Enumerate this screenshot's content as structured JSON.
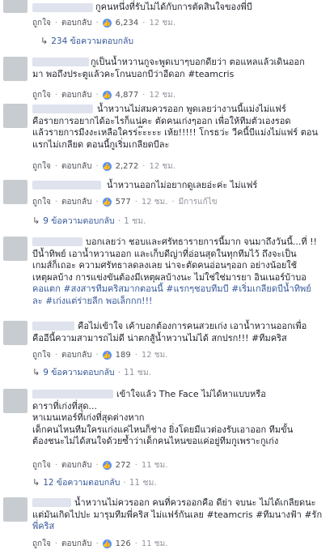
{
  "labels": {
    "like": "ถูกใจ",
    "reply": "ตอบกลับ",
    "edited": "มีการแก้ไข"
  },
  "comments": [
    {
      "lines": [
        "กูคนหนึ่งที่รับไม่ได้กับการตัดสินใจของพี่บี"
      ],
      "likes": "6,234",
      "time": "12 ชม.",
      "edited": false,
      "replies": "234 ข้อความตอบกลับ",
      "replies_time": ""
    },
    {
      "lines": [
        "กูเป็นน้ำหวานกูจะพูดเบาๆบอกดียว่า ตอแหลแล้วเดินออก",
        "มา พอถึงประตูแล้วคะโกนบอกบีว่าอีดอก #teamcris"
      ],
      "likes": "4,877",
      "time": "12 ชม.",
      "edited": false,
      "replies": "",
      "replies_time": ""
    },
    {
      "lines": [
        "น้ำหวานไม่สมควรออก พูดเลยว่างานนี้แม่งไม่แฟร์",
        "คือรายการอยากได้อะไรก็แน่คะ ตัดคนเก่งๆออก เพื่อให้ทีมตัวเองรอด",
        "แล้วรายการมีงงะเหลือใครร่ะ๊ะะะะ เห้ย!!!!! โกรธว่ะ วีคนี้บีแม่งไม่แฟร์ ตอน",
        "แรกไม่เกลียด ตอนนี้กูเริ่มเกลียดบีละ"
      ],
      "likes": "2,272",
      "time": "12 ชม.",
      "edited": false,
      "replies": "",
      "replies_time": ""
    },
    {
      "lines": [
        "น้ำหวานออกไม่อยากดูเลยอ่ะค่ะ ไม่แฟร์"
      ],
      "likes": "577",
      "time": "12 ชม.",
      "edited": true,
      "replies": "9 ข้อความตอบกลับ",
      "replies_time": "1 ชม."
    },
    {
      "lines": [
        "บอกเลยว่า ชอบและศรัทธารายการนี้มาก จนมาถึงวันนี้...ที่ !!",
        "บีน้ำทิพย์ เอาน้ำหวานออก และเก็บดีญ่าที่อ่อนสุดในทุกทีมไว้ ถึงจะเป็น",
        "เกมส์ก็เถอะ ความศรัทธาลดลงเลย น่าจะตัดคนอ่อนๆออก อย่างน้อยใช้",
        "เหตุผลบ้าง การแข่งขันต้องมีเหตุผลบ้างนะ ไม่ใช่ใช่มารยา อินเนอร์บ้าบอ",
        "คอแตก #สงสารทีมคริสมากตอนนี้ #แรกๆชอบทีมบี #เริ่มเกลียดบีน้ำทิพย์",
        "ละ #เก่งแต่ร่ายลีก พอเล็กกก!!!"
      ],
      "likes": "",
      "time": "",
      "edited": false,
      "replies": "",
      "replies_time": ""
    },
    {
      "lines": [
        "คือไม่เข้าใจ เค้าบอกต้องการคนสวยเก่ง เอาน้ำหวานออกเพื่อ",
        "คืออีนี้ความสามารถไม่ดี น่าตกสู้น้ำหวานไม่ได้ สกปรก!!! #ทีมคริส"
      ],
      "likes": "189",
      "time": "12 ชม.",
      "edited": false,
      "replies": "9 ข้อความตอบกลับ",
      "replies_time": "11 ชม."
    },
    {
      "lines": [
        "เข้าใจแล้ว The Face ไม่ได้หาแบบหรือ",
        "ดาราที่เก่งที่สุด...",
        "หาเมนเทอร์ที่เก่งที่สุดต่างหาก",
        "เด็กคนไหนทีมใครแก่งแค่ไหนก็ช่าง ยิ่งโดยมีแวต่องรับเอาออก ทีมขั้น",
        "ต้องชนะไม่ได้สนใจด้วยซ้ำว่าเด็กคนไหนขอแค่อยู่ทีมกูเพราะกูเก่ง"
      ],
      "likes": "272",
      "time": "11 ชม.",
      "edited": false,
      "replies": "12 ข้อความตอบกลับ",
      "replies_time": "11 ชม."
    },
    {
      "lines": [
        "น้ำหวานไม่ควรออก คนที่ควรออกคือ ดีย่า จบนะ ไม่ได้เกลียดนะ",
        "แต่มันเกิดไปปะ มารุมทีมพี่คริส ไม่แฟร์กันเลย #teamcris #ทีมนางฟ้า #รัก",
        "พี่คริส"
      ],
      "likes": "126",
      "time": "11 ชม.",
      "edited": false,
      "replies": "",
      "replies_time": ""
    }
  ]
}
